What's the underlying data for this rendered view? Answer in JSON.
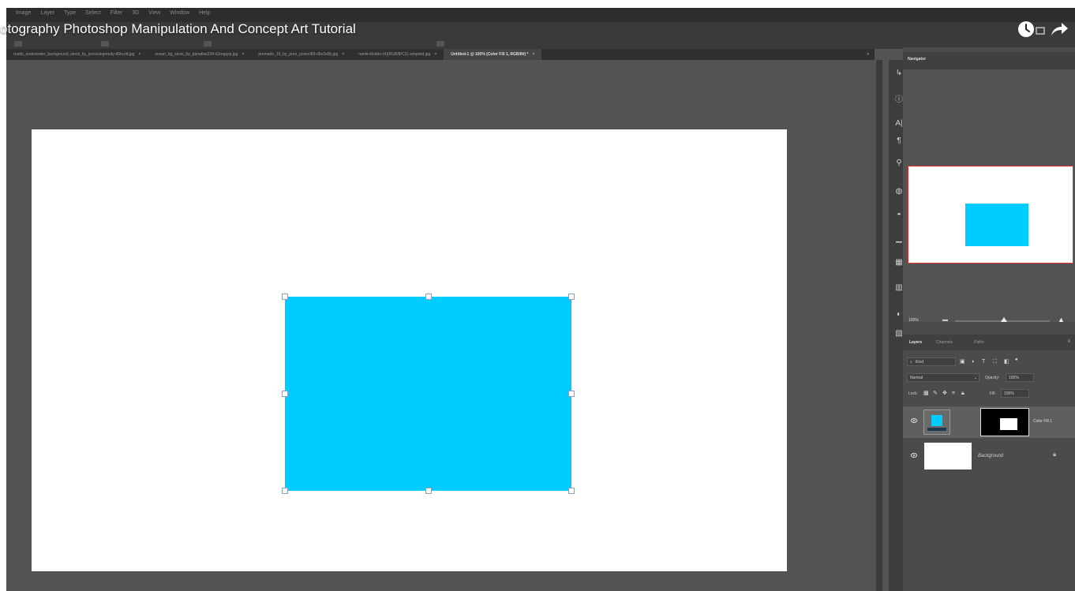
{
  "menu": {
    "items": [
      "Image",
      "Layer",
      "Type",
      "Select",
      "Filter",
      "3D",
      "View",
      "Window",
      "Help"
    ]
  },
  "video": {
    "title": "otography Photoshop Manipulation And Concept Art Tutorial",
    "watch_later_icon": "clock-icon",
    "share_icon": "share-arrow-icon"
  },
  "document_tabs": [
    {
      "label": "reado_underwater_background_stock_by_jessicakgreedy-d5kcztt.jpg",
      "close": "×",
      "active": false
    },
    {
      "label": "ocean_bg_stock_by_paradise234-d1mgqzp.jpg",
      "close": "×",
      "active": false
    },
    {
      "label": "premade_10_by_pure_poison89-d5e3s0b.jpg",
      "close": "×",
      "active": false
    },
    {
      "label": "ramie-klodde-(4)(RGB/8/CS) simplied.jpg",
      "close": "×",
      "active": false
    },
    {
      "label": "Untitled-1 @ 100% (Color Fill 1, RGB/8#) *",
      "close": "×",
      "active": true
    }
  ],
  "tabs_overflow": "»",
  "canvas": {
    "background": "#ffffff",
    "fill_color": "#00ccff"
  },
  "tool_strip_icons": [
    {
      "name": "history-icon",
      "glyph": "↳"
    },
    {
      "name": "info-icon",
      "glyph": "ⓘ"
    },
    {
      "name": "character-icon",
      "glyph": "A|"
    },
    {
      "name": "paragraph-icon",
      "glyph": "¶"
    },
    {
      "name": "light-bulb-icon",
      "glyph": "⚲"
    },
    {
      "name": "brush-icon",
      "glyph": "◍"
    },
    {
      "name": "clone-source-icon",
      "glyph": "◓"
    },
    {
      "name": "histogram-icon",
      "glyph": "▁"
    },
    {
      "name": "swatches-icon",
      "glyph": "▦"
    },
    {
      "name": "adjustments-icon",
      "glyph": "▥"
    },
    {
      "name": "color-icon",
      "glyph": "◐"
    },
    {
      "name": "layer-comps-icon",
      "glyph": "▧"
    }
  ],
  "navigator": {
    "tab_label": "Navigator",
    "zoom": "100%",
    "zoom_slider_position": 0.52,
    "preview_fill_color": "#00ccff"
  },
  "layers_panel": {
    "tabs": [
      "Layers",
      "Channels",
      "Paths"
    ],
    "active_tab": "Layers",
    "filter_kind": "Kind",
    "blend_mode": "Normal",
    "opacity_label": "Opacity:",
    "opacity_value": "100%",
    "lock_label": "Lock:",
    "fill_label": "Fill:",
    "fill_value": "100%",
    "layers": [
      {
        "name": "Color Fill 1",
        "selected": true
      },
      {
        "name": "Background",
        "selected": false
      }
    ]
  }
}
